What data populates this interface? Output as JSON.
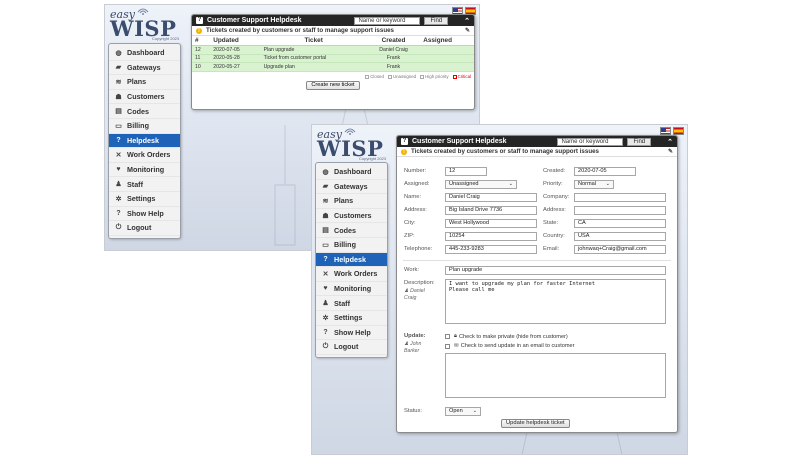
{
  "logo": {
    "easy": "easy",
    "wisp": "WISP",
    "copyright": "Copyright 2023"
  },
  "flags": {
    "english": "US flag",
    "spanish": "Spain flag"
  },
  "nav": [
    {
      "label": "Dashboard",
      "icon": "dashboard-icon",
      "glyph": "◍"
    },
    {
      "label": "Gateways",
      "icon": "gateway-icon",
      "glyph": "▰"
    },
    {
      "label": "Plans",
      "icon": "plans-icon",
      "glyph": "≋"
    },
    {
      "label": "Customers",
      "icon": "customers-icon",
      "glyph": "☗"
    },
    {
      "label": "Codes",
      "icon": "codes-icon",
      "glyph": "▤"
    },
    {
      "label": "Billing",
      "icon": "billing-icon",
      "glyph": "▭"
    },
    {
      "label": "Helpdesk",
      "icon": "helpdesk-icon",
      "glyph": "?"
    },
    {
      "label": "Work Orders",
      "icon": "work-orders-icon",
      "glyph": "✕"
    },
    {
      "label": "Monitoring",
      "icon": "monitoring-icon",
      "glyph": "♥"
    },
    {
      "label": "Staff",
      "icon": "staff-icon",
      "glyph": "♟"
    },
    {
      "label": "Settings",
      "icon": "settings-icon",
      "glyph": "✲"
    },
    {
      "label": "Show Help",
      "icon": "help-icon",
      "glyph": "?"
    },
    {
      "label": "Logout",
      "icon": "logout-icon",
      "glyph": "⏻"
    }
  ],
  "active_nav": "Helpdesk",
  "helpdesk": {
    "title": "Customer Support Helpdesk",
    "search_placeholder": "Name or keyword",
    "find_label": "Find",
    "collapse_glyph": "⌃",
    "subtitle": "Tickets created by customers or staff to manage support issues"
  },
  "list": {
    "columns": [
      "#",
      "Updated",
      "Ticket",
      "Created",
      "Assigned"
    ],
    "rows": [
      {
        "num": "12",
        "updated": "2020-07-05",
        "ticket": "Plan upgrade",
        "created": "Daniel Craig",
        "assigned": ""
      },
      {
        "num": "11",
        "updated": "2020-05-28",
        "ticket": "Ticket from customer portal",
        "created": "Frank",
        "assigned": ""
      },
      {
        "num": "10",
        "updated": "2020-05-27",
        "ticket": "Upgrade plan",
        "created": "Frank",
        "assigned": ""
      }
    ],
    "legend": {
      "closed": "Closed",
      "unassigned": "Unassigned",
      "high": "High priority",
      "critical": "Critical"
    },
    "create_label": "Create new ticket"
  },
  "form": {
    "number_label": "Number:",
    "number_value": "12",
    "created_label": "Created:",
    "created_value": "2020-07-05",
    "assigned_label": "Assigned:",
    "assigned_value": "Unassigned",
    "priority_label": "Priority:",
    "priority_value": "Normal",
    "name_label": "Name:",
    "name_value": "Daniel Craig",
    "company_label": "Company:",
    "company_value": "",
    "address_label": "Address:",
    "address_value": "Big Island Drive 7736",
    "address2_label": "Address:",
    "address2_value": "",
    "city_label": "City:",
    "city_value": "West Hollywood",
    "state_label": "State:",
    "state_value": "CA",
    "zip_label": "ZIP:",
    "zip_value": "10254",
    "country_label": "Country:",
    "country_value": "USA",
    "telephone_label": "Telephone:",
    "telephone_value": "445-233-9283",
    "email_label": "Email:",
    "email_value": "johnwaq+Craig@gmail.com",
    "work_label": "Work:",
    "work_value": "Plan upgrade",
    "description_label": "Description:",
    "description_author": "Daniel Craig",
    "description_value": "I want to upgrade my plan for faster Internet\nPlease call me",
    "update_label": "Update:",
    "update_author": "John Barker",
    "private_label": "Check to make private (hide from customer)",
    "email_update_label": "Check to send update in an email to customer",
    "update_value": "",
    "status_label": "Status:",
    "status_value": "Open",
    "submit_label": "Update helpdesk ticket"
  }
}
